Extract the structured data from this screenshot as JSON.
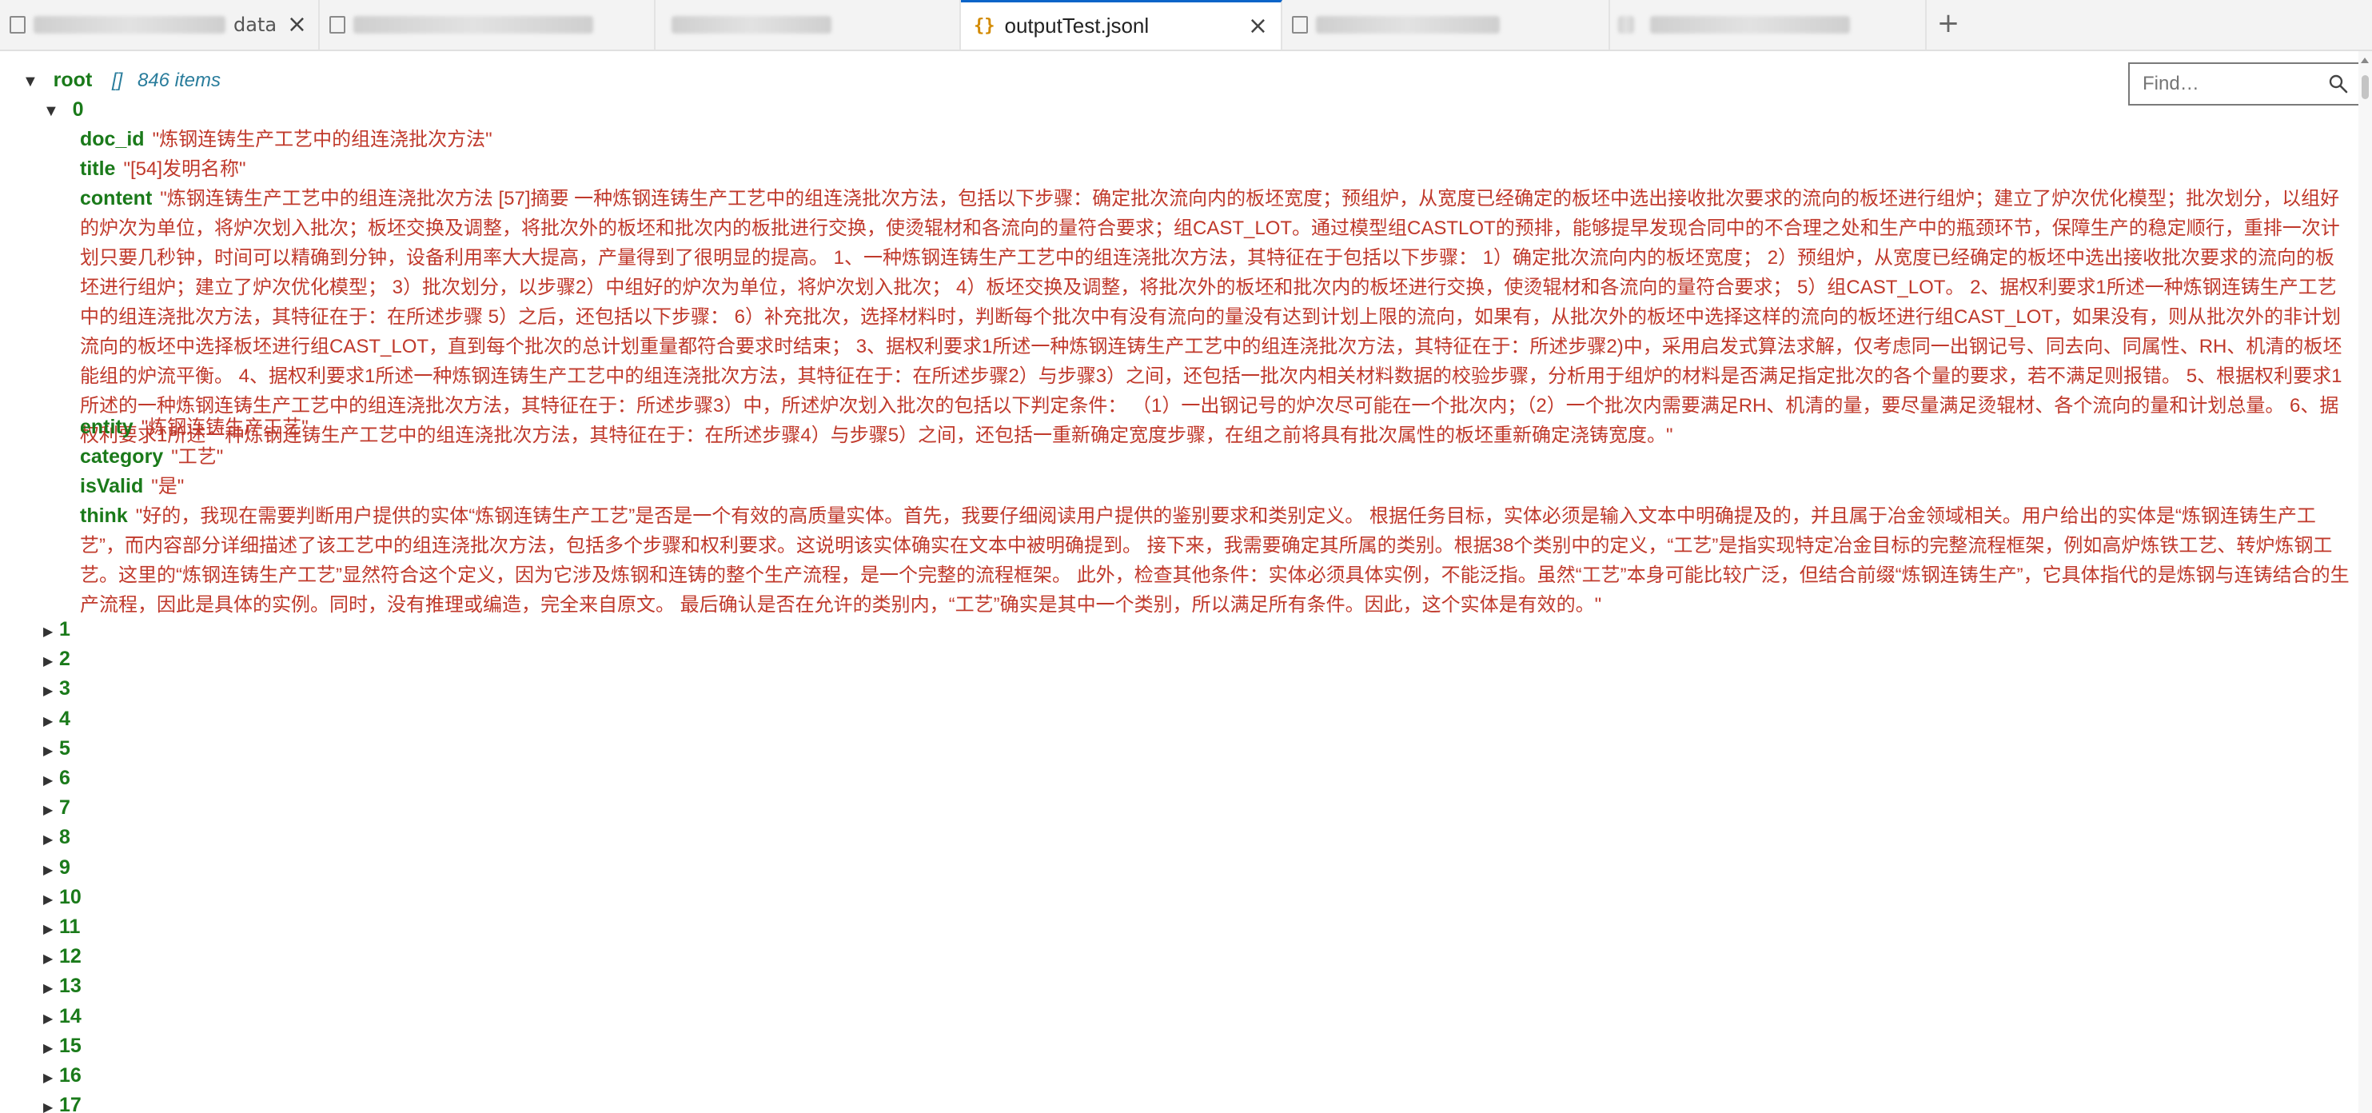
{
  "tabs": [
    {
      "label": "data",
      "active": false
    },
    {
      "label": "",
      "active": false
    },
    {
      "label": "",
      "active": false
    },
    {
      "label": "outputTest.jsonl",
      "active": true
    },
    {
      "label": "",
      "active": false
    },
    {
      "label": "",
      "active": false
    }
  ],
  "new_tab_label": "+",
  "close_label": "×",
  "find": {
    "placeholder": "Find…"
  },
  "tree": {
    "root_key": "root",
    "root_meta_brackets": "[]",
    "root_meta_count": "846 items",
    "expanded_index": "0",
    "record": {
      "doc_id": {
        "key": "doc_id",
        "value": "\"炼钢连铸生产工艺中的组连浇批次方法\""
      },
      "title": {
        "key": "title",
        "value": "\"[54]发明名称\""
      },
      "content": {
        "key": "content",
        "value": "\"炼钢连铸生产工艺中的组连浇批次方法 [57]摘要 一种炼钢连铸生产工艺中的组连浇批次方法，包括以下步骤：确定批次流向内的板坯宽度；预组炉，从宽度已经确定的板坯中选出接收批次要求的流向的板坯进行组炉；建立了炉次优化模型；批次划分，以组好的炉次为单位，将炉次划入批次；板坯交换及调整，将批次外的板坯和批次内的板批进行交换，使烫辊材和各流向的量符合要求；组CAST_LOT。通过模型组CASTLOT的预排，能够提早发现合同中的不合理之处和生产中的瓶颈环节，保障生产的稳定顺行，重排一次计划只要几秒钟，时间可以精确到分钟，设备利用率大大提高，产量得到了很明显的提高。 1、一种炼钢连铸生产工艺中的组连浇批次方法，其特征在于包括以下步骤： 1）确定批次流向内的板坯宽度； 2）预组炉，从宽度已经确定的板坯中选出接收批次要求的流向的板坯进行组炉；建立了炉次优化模型； 3）批次划分，以步骤2）中组好的炉次为单位，将炉次划入批次； 4）板坯交换及调整，将批次外的板坯和批次内的板坯进行交换，使烫辊材和各流向的量符合要求； 5）组CAST_LOT。 2、据权利要求1所述一种炼钢连铸生产工艺中的组连浇批次方法，其特征在于：在所述步骤 5）之后，还包括以下步骤： 6）补充批次，选择材料时，判断每个批次中有没有流向的量没有达到计划上限的流向，如果有，从批次外的板坯中选择这样的流向的板坯进行组CAST_LOT，如果没有，则从批次外的非计划流向的板坯中选择板坯进行组CAST_LOT，直到每个批次的总计划重量都符合要求时结束； 3、据权利要求1所述一种炼钢连铸生产工艺中的组连浇批次方法，其特征在于：所述步骤2)中，采用启发式算法求解，仅考虑同一出钢记号、同去向、同属性、RH、机清的板坯能组的炉流平衡。 4、据权利要求1所述一种炼钢连铸生产工艺中的组连浇批次方法，其特征在于：在所述步骤2）与步骤3）之间，还包括一批次内相关材料数据的校验步骤，分析用于组炉的材料是否满足指定批次的各个量的要求，若不满足则报错。 5、根据权利要求1所述的一种炼钢连铸生产工艺中的组连浇批次方法，其特征在于：所述步骤3）中，所述炉次划入批次的包括以下判定条件： （1）一出钢记号的炉次尽可能在一个批次内；（2）一个批次内需要满足RH、机清的量，要尽量满足烫辊材、各个流向的量和计划总量。 6、据权利要求1所述一种炼钢连铸生产工艺中的组连浇批次方法，其特征在于：在所述步骤4）与步骤5）之间，还包括一重新确定宽度步骤，在组之前将具有批次属性的板坯重新确定浇铸宽度。\""
      },
      "entity": {
        "key": "entity",
        "value": "\"炼钢连铸生产工艺\""
      },
      "category": {
        "key": "category",
        "value": "\"工艺\""
      },
      "isValid": {
        "key": "isValid",
        "value": "\"是\""
      },
      "think": {
        "key": "think",
        "value": "\"好的，我现在需要判断用户提供的实体“炼钢连铸生产工艺”是否是一个有效的高质量实体。首先，我要仔细阅读用户提供的鉴别要求和类别定义。 根据任务目标，实体必须是输入文本中明确提及的，并且属于冶金领域相关。用户给出的实体是“炼钢连铸生产工艺”，而内容部分详细描述了该工艺中的组连浇批次方法，包括多个步骤和权利要求。这说明该实体确实在文本中被明确提到。 接下来，我需要确定其所属的类别。根据38个类别中的定义，“工艺”是指实现特定冶金目标的完整流程框架，例如高炉炼铁工艺、转炉炼钢工艺。这里的“炼钢连铸生产工艺”显然符合这个定义，因为它涉及炼钢和连铸的整个生产流程，是一个完整的流程框架。 此外，检查其他条件：实体必须具体实例，不能泛指。虽然“工艺”本身可能比较广泛，但结合前缀“炼钢连铸生产”，它具体指代的是炼钢与连铸结合的生产流程，因此是具体的实例。同时，没有推理或编造，完全来自原文。 最后确认是否在允许的类别内，“工艺”确实是其中一个类别，所以满足所有条件。因此，这个实体是有效的。\""
      }
    },
    "collapsed_indices": [
      "1",
      "2",
      "3",
      "4",
      "5",
      "6",
      "7",
      "8",
      "9",
      "10",
      "11",
      "12",
      "13",
      "14",
      "15",
      "16",
      "17"
    ]
  }
}
